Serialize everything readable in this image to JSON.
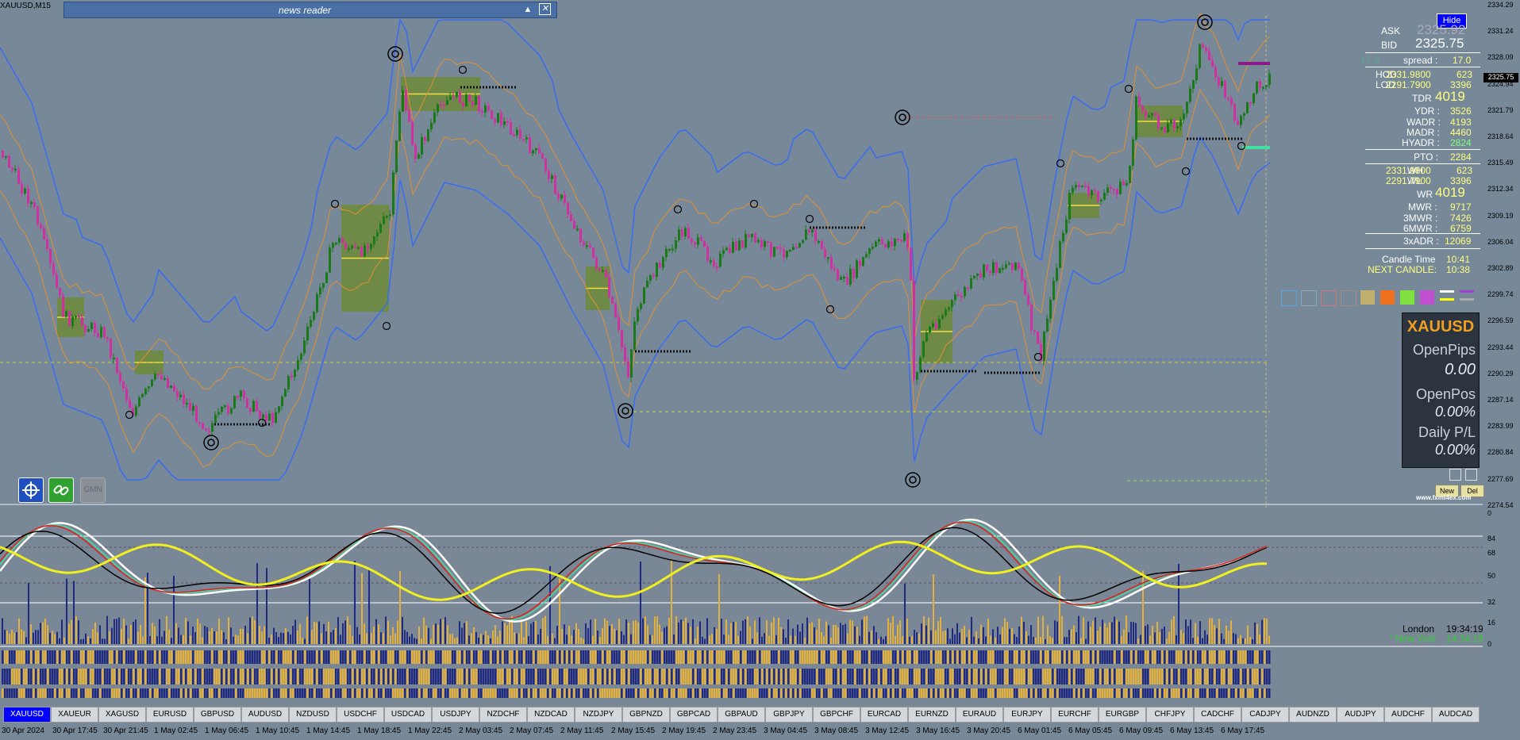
{
  "window": {
    "title": "XAUUSD,M15"
  },
  "news_reader": {
    "title": "news reader",
    "collapse_icon": "▲",
    "close_icon": "✕"
  },
  "price_axis": [
    "2334.29",
    "2331.24",
    "2328.09",
    "2324.94",
    "2321.79",
    "2318.64",
    "2315.49",
    "2312.34",
    "2309.19",
    "2306.04",
    "2302.89",
    "2299.74",
    "2296.59",
    "2293.44",
    "2290.29",
    "2287.14",
    "2283.99",
    "2280.84",
    "2277.69",
    "2274.54"
  ],
  "current_price_tag": "2325.75",
  "indicator_axis": [
    "0",
    "84",
    "68",
    "50",
    "32",
    "16",
    "0"
  ],
  "info": {
    "hide_label": "Hide",
    "ask_label": "ASK",
    "ask_value": "2325.92",
    "bid_label": "BID",
    "bid_value": "2325.75",
    "spread_label": "spread :",
    "spread_value": "17.0",
    "spread_ghost": "17.0",
    "hod_label": "HOD",
    "hod_price": "2331.9800",
    "hod_value": "623",
    "lod_label": "LOD",
    "lod_price": "2291.7900",
    "lod_value": "3396",
    "tdr_label": "TDR",
    "tdr_value": "4019",
    "ydr_label": "YDR :",
    "ydr_value": "3526",
    "wadr_label": "WADR :",
    "wadr_value": "4193",
    "madr_label": "MADR :",
    "madr_value": "4460",
    "hyadr_label": "HYADR :",
    "hyadr_value": "2824",
    "pto_label": "PTO :",
    "pto_value": "2284",
    "wh_label": "WH",
    "wh_price": "2331.9800",
    "wh_value": "623",
    "wl_label": "WL",
    "wl_price": "2291.7900",
    "wl_value": "3396",
    "wr_label": "WR",
    "wr_value": "4019",
    "mwr_label": "MWR :",
    "mwr_value": "9717",
    "mwr3_label": "3MWR :",
    "mwr3_value": "7426",
    "mwr6_label": "6MWR :",
    "mwr6_value": "6759",
    "xadr_label": "3xADR :",
    "xadr_value": "12069",
    "candle_time_label": "Candle Time",
    "candle_time_value": "10:41",
    "next_candle_label": "NEXT CANDLE:",
    "next_candle_value": "10:38"
  },
  "trade_panel": {
    "symbol": "XAUUSD",
    "open_pips_label": "OpenPips",
    "open_pips_value": "0.00",
    "open_pos_label": "OpenPos",
    "open_pos_value": "0.00%",
    "daily_pl_label": "Daily P/L",
    "daily_pl_value": "0.00%",
    "new_label": "New",
    "del_label": "Del",
    "site": "www.fxmt4ex.com"
  },
  "tools": {
    "gmm_label": "GMN"
  },
  "sessions": {
    "london_label": "London",
    "london_time": "19:34:19",
    "newyork_label": "* New York",
    "newyork_time": "14:34:19"
  },
  "colors": {
    "bull": "#1a7a1a",
    "bear": "#d030a0",
    "band_outer": "#3a6cf0",
    "band_inner": "#e09030",
    "box": "#6a8a10",
    "tab_active": "#0000ff"
  },
  "symbols": [
    "XAUUSD",
    "XAUEUR",
    "XAGUSD",
    "EURUSD",
    "GBPUSD",
    "AUDUSD",
    "NZDUSD",
    "USDCHF",
    "USDCAD",
    "USDJPY",
    "NZDCHF",
    "NZDCAD",
    "NZDJPY",
    "GBPNZD",
    "GBPCAD",
    "GBPAUD",
    "GBPJPY",
    "GBPCHF",
    "EURCAD",
    "EURNZD",
    "EURAUD",
    "EURJPY",
    "EURCHF",
    "EURGBP",
    "CHFJPY",
    "CADCHF",
    "CADJPY",
    "AUDNZD",
    "AUDJPY",
    "AUDCHF",
    "AUDCAD"
  ],
  "time_axis": [
    "30 Apr 2024",
    "30 Apr 17:45",
    "30 Apr 21:45",
    "1 May 02:45",
    "1 May 06:45",
    "1 May 10:45",
    "1 May 14:45",
    "1 May 18:45",
    "1 May 22:45",
    "2 May 03:45",
    "2 May 07:45",
    "2 May 11:45",
    "2 May 15:45",
    "2 May 19:45",
    "2 May 23:45",
    "3 May 04:45",
    "3 May 08:45",
    "3 May 12:45",
    "3 May 16:45",
    "3 May 20:45",
    "6 May 01:45",
    "6 May 05:45",
    "6 May 09:45",
    "6 May 13:45",
    "6 May 17:45"
  ]
}
